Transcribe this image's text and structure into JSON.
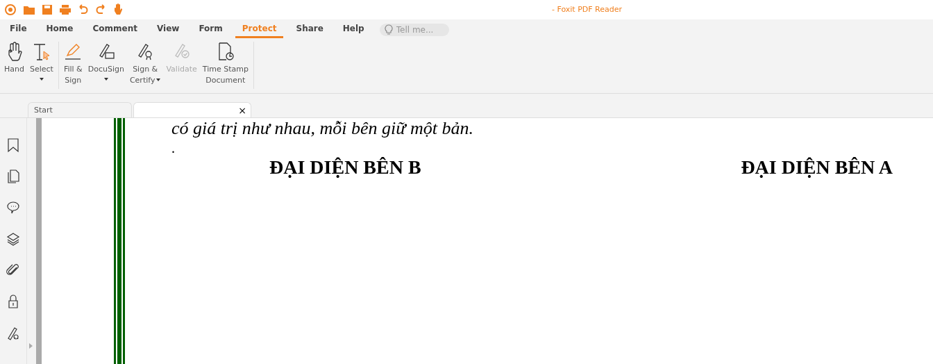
{
  "window": {
    "title": "- Foxit PDF Reader"
  },
  "menu": [
    {
      "label": "File",
      "selected": false
    },
    {
      "label": "Home",
      "selected": false
    },
    {
      "label": "Comment",
      "selected": false
    },
    {
      "label": "View",
      "selected": false
    },
    {
      "label": "Form",
      "selected": false
    },
    {
      "label": "Protect",
      "selected": true
    },
    {
      "label": "Share",
      "selected": false
    },
    {
      "label": "Help",
      "selected": false
    }
  ],
  "search": {
    "placeholder": "Tell me..."
  },
  "ribbon": [
    {
      "kind": "hand",
      "lines": [
        "Hand"
      ],
      "dropdown": false,
      "disabled": false
    },
    {
      "kind": "select",
      "lines": [
        "Select"
      ],
      "dropdown": true,
      "disabled": false
    },
    {
      "kind": "fill",
      "lines": [
        "Fill &",
        "Sign"
      ],
      "dropdown": false,
      "disabled": false
    },
    {
      "kind": "docusign",
      "lines": [
        "DocuSign"
      ],
      "dropdown": true,
      "disabled": false
    },
    {
      "kind": "certify",
      "lines": [
        "Sign &",
        "Certify"
      ],
      "dropdown": true,
      "disabled": false
    },
    {
      "kind": "validate",
      "lines": [
        "Validate"
      ],
      "dropdown": false,
      "disabled": true
    },
    {
      "kind": "timestamp",
      "lines": [
        "Time Stamp",
        "Document"
      ],
      "dropdown": false,
      "disabled": false
    }
  ],
  "tabs": [
    {
      "label": "Start",
      "selected": false
    },
    {
      "close": "×",
      "selected": true
    }
  ],
  "document": {
    "cut_line": "có giá trị như nhau, mỗi bên giữ một bản.",
    "dot": ".",
    "left_heading": "ĐẠI DIỆN BÊN B",
    "right_heading": "ĐẠI DIỆN BÊN A"
  }
}
